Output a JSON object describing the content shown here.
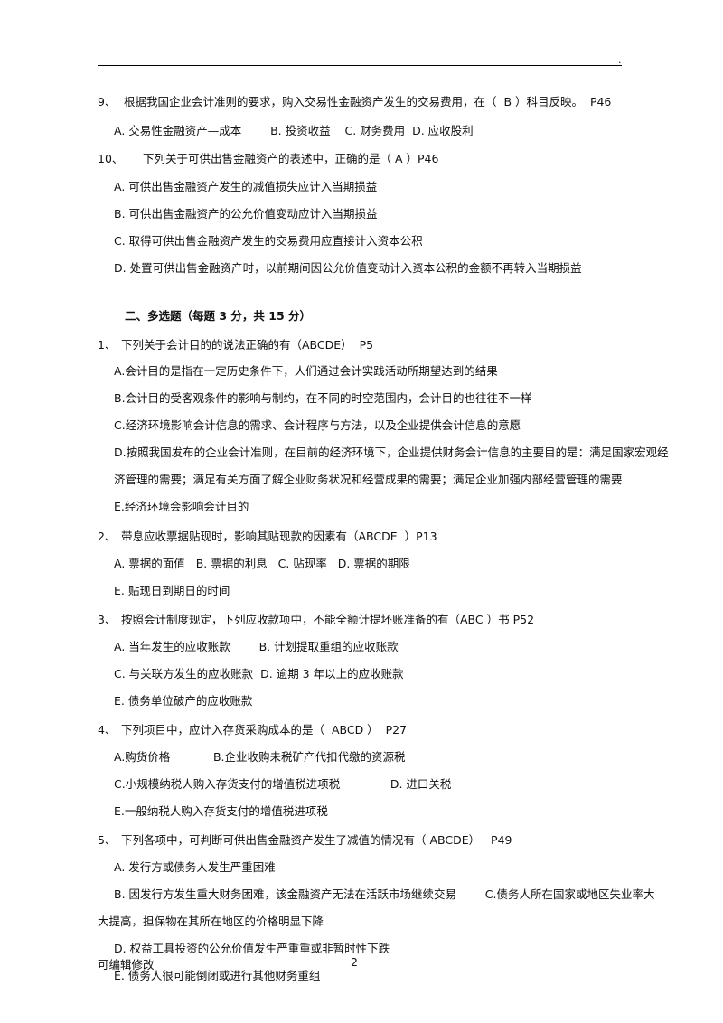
{
  "page": {
    "header_mark": ".",
    "footer_left": "可编辑修改",
    "page_number": "2"
  },
  "section_single_choice_tail": {
    "items": [
      {
        "number": "9、",
        "stem": "根据我国企业会计准则的要求，购入交易性金融资产发生的交易费用，在（  B ）科目反映。  P46",
        "options": [
          "A. 交易性金融资产—成本        B. 投资收益    C. 财务费用  D. 应收股利"
        ]
      },
      {
        "number": "10、",
        "stem": "下列关于可供出售金融资产的表述中，正确的是（ A ）P46",
        "options": [
          "A. 可供出售金融资产发生的减值损失应计入当期损益",
          "B. 可供出售金融资产的公允价值变动应计入当期损益",
          "C. 取得可供出售金融资产发生的交易费用应直接计入资本公积",
          "D. 处置可供出售金融资产时，以前期间因公允价值变动计入资本公积的金额不再转入当期损益"
        ]
      }
    ]
  },
  "section_multi_choice": {
    "title": "二、多选题（每题 3 分，共 15 分）",
    "items": [
      {
        "number": "1、",
        "stem": "下列关于会计目的的说法正确的有（ABCDE）  P5",
        "options": [
          "A.会计目的是指在一定历史条件下，人们通过会计实践活动所期望达到的结果",
          "B.会计目的受客观条件的影响与制约，在不同的时空范围内，会计目的也往往不一样",
          "C.经济环境影响会计信息的需求、会计程序与方法，以及企业提供会计信息的意愿",
          "D.按照我国发布的企业会计准则，在目前的经济环境下，企业提供财务会计信息的主要目的是：满足国家宏观经",
          "济管理的需要；满足有关方面了解企业财务状况和经营成果的需要；满足企业加强内部经营管理的需要",
          "E.经济环境会影响会计目的"
        ]
      },
      {
        "number": "2、",
        "stem": "带息应收票据贴现时，影响其贴现款的因素有（ABCDE  ）P13",
        "options": [
          "A. 票据的面值   B. 票据的利息   C. 贴现率   D. 票据的期限",
          "E. 贴现日到期日的时间"
        ]
      },
      {
        "number": "3、",
        "stem": "按照会计制度规定，下列应收款项中，不能全额计提坏账准备的有（ABC ）书 P52",
        "options": [
          "A. 当年发生的应收账款        B. 计划提取重组的应收账款",
          "C. 与关联方发生的应收账款  D. 逾期 3 年以上的应收账款",
          "E. 债务单位破产的应收账款"
        ]
      },
      {
        "number": "4、",
        "stem": "下列项目中，应计入存货采购成本的是（  ABCD ）  P27",
        "options": [
          "A.购货价格            B.企业收购未税矿产代扣代缴的资源税",
          "C.小规模纳税人购入存货支付的增值税进项税              D. 进口关税",
          "E.一般纳税人购入存货支付的增值税进项税"
        ]
      },
      {
        "number": "5、",
        "stem": "下列各项中，可判断可供出售金融资产发生了减值的情况有（ ABCDE）   P49",
        "options": [
          "A. 发行方或债务人发生严重困难",
          "B. 因发行方发生重大财务困难，该金融资产无法在活跃市场继续交易        C.债务人所在国家或地区失业率大",
          "大提高，担保物在其所在地区的价格明显下降",
          "D. 权益工具投资的公允价值发生严重重或非暂时性下跌",
          "E. 债务人很可能倒闭或进行其他财务重组"
        ]
      }
    ]
  }
}
